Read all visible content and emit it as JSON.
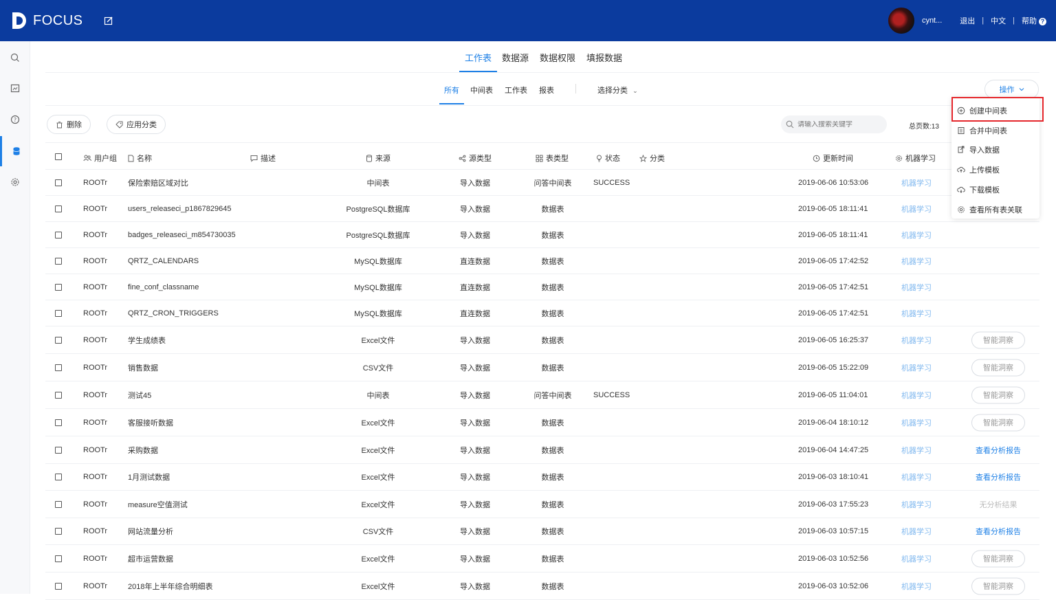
{
  "header": {
    "logo_text": "FOCUS",
    "username": "cynt...",
    "logout": "退出",
    "lang": "中文",
    "help": "帮助",
    "help_glyph": "?",
    "sep": "|"
  },
  "main_tabs": [
    "工作表",
    "数据源",
    "数据权限",
    "填报数据"
  ],
  "sub_tabs": [
    "所有",
    "中间表",
    "工作表",
    "报表"
  ],
  "select_category": "选择分类",
  "ops_button": "操作",
  "actions": {
    "delete": "删除",
    "apply_category": "应用分类"
  },
  "search": {
    "placeholder": "请输入搜索关键字"
  },
  "total_pages": "总页数:13",
  "columns": {
    "user_group": "用户组",
    "name": "名称",
    "desc": "描述",
    "source": "来源",
    "source_type": "源类型",
    "table_type": "表类型",
    "status": "状态",
    "category": "分类",
    "updated": "更新时间",
    "ml": "机器学习"
  },
  "rows": [
    {
      "group": "ROOTr",
      "name": "保险索赔区域对比",
      "source": "中间表",
      "stype": "导入数据",
      "ttype": "问答中间表",
      "status": "SUCCESS",
      "time": "2019-06-06 10:53:06",
      "ml": "机器学习",
      "action": ""
    },
    {
      "group": "ROOTr",
      "name": "users_releaseci_p1867829645",
      "source": "PostgreSQL数据库",
      "stype": "导入数据",
      "ttype": "数据表",
      "status": "",
      "time": "2019-06-05 18:11:41",
      "ml": "机器学习",
      "action": ""
    },
    {
      "group": "ROOTr",
      "name": "badges_releaseci_m854730035",
      "source": "PostgreSQL数据库",
      "stype": "导入数据",
      "ttype": "数据表",
      "status": "",
      "time": "2019-06-05 18:11:41",
      "ml": "机器学习",
      "action": ""
    },
    {
      "group": "ROOTr",
      "name": "QRTZ_CALENDARS",
      "source": "MySQL数据库",
      "stype": "直连数据",
      "ttype": "数据表",
      "status": "",
      "time": "2019-06-05 17:42:52",
      "ml": "机器学习",
      "action": ""
    },
    {
      "group": "ROOTr",
      "name": "fine_conf_classname",
      "source": "MySQL数据库",
      "stype": "直连数据",
      "ttype": "数据表",
      "status": "",
      "time": "2019-06-05 17:42:51",
      "ml": "机器学习",
      "action": ""
    },
    {
      "group": "ROOTr",
      "name": "QRTZ_CRON_TRIGGERS",
      "source": "MySQL数据库",
      "stype": "直连数据",
      "ttype": "数据表",
      "status": "",
      "time": "2019-06-05 17:42:51",
      "ml": "机器学习",
      "action": ""
    },
    {
      "group": "ROOTr",
      "name": "学生成绩表",
      "source": "Excel文件",
      "stype": "导入数据",
      "ttype": "数据表",
      "status": "",
      "time": "2019-06-05 16:25:37",
      "ml": "机器学习",
      "action": "智能洞察",
      "atype": "btn"
    },
    {
      "group": "ROOTr",
      "name": "销售数据",
      "source": "CSV文件",
      "stype": "导入数据",
      "ttype": "数据表",
      "status": "",
      "time": "2019-06-05 15:22:09",
      "ml": "机器学习",
      "action": "智能洞察",
      "atype": "btn"
    },
    {
      "group": "ROOTr",
      "name": "测试45",
      "source": "中间表",
      "stype": "导入数据",
      "ttype": "问答中间表",
      "status": "SUCCESS",
      "time": "2019-06-05 11:04:01",
      "ml": "机器学习",
      "action": "智能洞察",
      "atype": "btn"
    },
    {
      "group": "ROOTr",
      "name": "客服接听数据",
      "source": "Excel文件",
      "stype": "导入数据",
      "ttype": "数据表",
      "status": "",
      "time": "2019-06-04 18:10:12",
      "ml": "机器学习",
      "action": "智能洞察",
      "atype": "btn"
    },
    {
      "group": "ROOTr",
      "name": "采购数据",
      "source": "Excel文件",
      "stype": "导入数据",
      "ttype": "数据表",
      "status": "",
      "time": "2019-06-04 14:47:25",
      "ml": "机器学习",
      "action": "查看分析报告",
      "atype": "link"
    },
    {
      "group": "ROOTr",
      "name": "1月测试数据",
      "source": "Excel文件",
      "stype": "导入数据",
      "ttype": "数据表",
      "status": "",
      "time": "2019-06-03 18:10:41",
      "ml": "机器学习",
      "action": "查看分析报告",
      "atype": "link"
    },
    {
      "group": "ROOTr",
      "name": "measure空值测试",
      "source": "Excel文件",
      "stype": "导入数据",
      "ttype": "数据表",
      "status": "",
      "time": "2019-06-03 17:55:23",
      "ml": "机器学习",
      "action": "无分析结果",
      "atype": "none"
    },
    {
      "group": "ROOTr",
      "name": "网站流量分析",
      "source": "CSV文件",
      "stype": "导入数据",
      "ttype": "数据表",
      "status": "",
      "time": "2019-06-03 10:57:15",
      "ml": "机器学习",
      "action": "查看分析报告",
      "atype": "link"
    },
    {
      "group": "ROOTr",
      "name": "超市运营数据",
      "source": "Excel文件",
      "stype": "导入数据",
      "ttype": "数据表",
      "status": "",
      "time": "2019-06-03 10:52:56",
      "ml": "机器学习",
      "action": "智能洞察",
      "atype": "btn"
    },
    {
      "group": "ROOTr",
      "name": "2018年上半年综合明细表",
      "source": "Excel文件",
      "stype": "导入数据",
      "ttype": "数据表",
      "status": "",
      "time": "2019-06-03 10:52:06",
      "ml": "机器学习",
      "action": "智能洞察",
      "atype": "btn"
    }
  ],
  "dropdown": [
    {
      "label": "创建中间表",
      "icon": "plus-circle-icon"
    },
    {
      "label": "合并中间表",
      "icon": "merge-icon"
    },
    {
      "label": "导入数据",
      "icon": "import-icon"
    },
    {
      "label": "上传模板",
      "icon": "cloud-upload-icon"
    },
    {
      "label": "下载模板",
      "icon": "cloud-download-icon"
    },
    {
      "label": "查看所有表关联",
      "icon": "gear-icon"
    }
  ],
  "colors": {
    "brand": "#0b3b9e",
    "accent": "#1e80e6",
    "highlight": "#e5262b"
  }
}
